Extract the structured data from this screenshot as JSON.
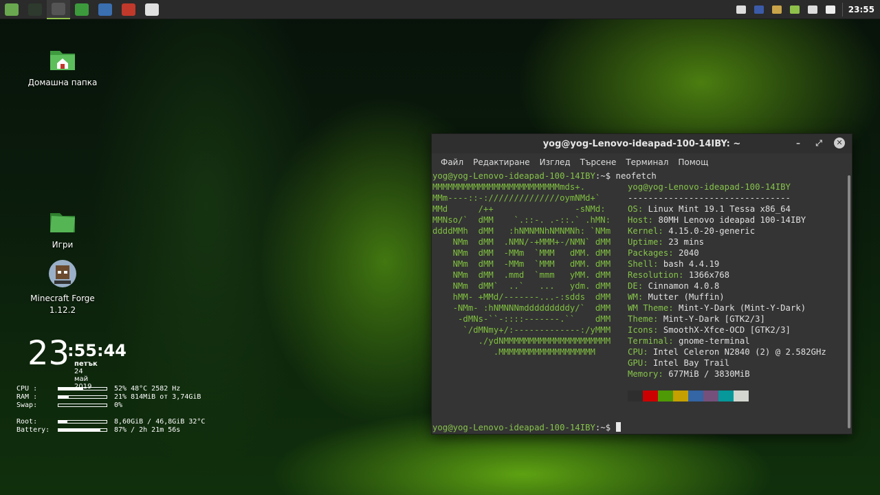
{
  "panel": {
    "launchers": [
      {
        "name": "mint-menu-icon",
        "color": "#6aa84f"
      },
      {
        "name": "terminal-launcher-icon",
        "color": "#2d3a2d"
      },
      {
        "name": "terminal-window-icon",
        "color": "#555"
      },
      {
        "name": "files-launcher-icon",
        "color": "#3c9a3c"
      },
      {
        "name": "browser-launcher-icon",
        "color": "#3a6fb0"
      },
      {
        "name": "monitor-launcher-icon",
        "color": "#c0392b"
      },
      {
        "name": "shield-launcher-icon",
        "color": "#e0e0e0"
      }
    ],
    "tray": [
      "shield-tray-icon",
      "us-flag-icon",
      "folder-tray-icon",
      "network-icon",
      "volume-icon",
      "battery-icon"
    ],
    "clock": "23:55"
  },
  "desktop": {
    "icons": [
      {
        "label": "Домашна папка"
      },
      {
        "label": "Игри"
      },
      {
        "label_line1": "Minecraft Forge",
        "label_line2": "1.12.2"
      }
    ]
  },
  "conky": {
    "hour": "23",
    "min_sec": ":55:44",
    "day": "петък",
    "date": "24 май 2019",
    "stats": [
      {
        "key": "CPU :",
        "fill": 0.52,
        "value": "52%  48°C 2582 Hz"
      },
      {
        "key": "RAM :",
        "fill": 0.21,
        "value": "21% 814MiB от 3,74GiB"
      },
      {
        "key": "Swap:",
        "fill": 0.0,
        "value": "0%"
      },
      {
        "key": "Root:",
        "fill": 0.19,
        "value": "8,60GiB / 46,8GiB 32°C"
      },
      {
        "key": "Battery:",
        "fill": 0.87,
        "value": "87% / 2h 21m 56s"
      }
    ]
  },
  "terminal": {
    "title": "yog@yog-Lenovo-ideapad-100-14IBY: ~",
    "menu": [
      "Файл",
      "Редактиране",
      "Изглед",
      "Търсене",
      "Терминал",
      "Помощ"
    ],
    "prompt": "yog@yog-Lenovo-ideapad-100-14IBY",
    "prompt_suffix": ":~$",
    "command": " neofetch",
    "logo_lines": [
      "MMMMMMMMMMMMMMMMMMMMMMMMMmds+.",
      "MMm----::-://////////////oymNMd+`",
      "MMd      /++                -sNMd:",
      "MMNso/`  dMM    `.::-. .-::.` .hMN:",
      "ddddMMh  dMM   :hNMNMNhNMNMNh: `NMm",
      "    NMm  dMM  .NMN/-+MMM+-/NMN` dMM",
      "    NMm  dMM  -MMm  `MMM   dMM. dMM",
      "    NMm  dMM  -MMm  `MMM   dMM. dMM",
      "    NMm  dMM  .mmd  `mmm   yMM. dMM",
      "    NMm  dMM`  ..`   ...   ydm. dMM",
      "    hMM- +MMd/-------...-:sdds  dMM",
      "    -NMm- :hNMNNNmdddddddddy/`  dMM",
      "     -dMNs-``-::::-------.``    dMM",
      "      `/dMNmy+/:-------------:/yMMM",
      "         ./ydNMMMMMMMMMMMMMMMMMMMMM",
      "            .MMMMMMMMMMMMMMMMMMM"
    ],
    "info_title": "yog@yog-Lenovo-ideapad-100-14IBY",
    "info_sep": "--------------------------------",
    "info": [
      {
        "k": "OS",
        "v": "Linux Mint 19.1 Tessa x86_64"
      },
      {
        "k": "Host",
        "v": "80MH Lenovo ideapad 100-14IBY"
      },
      {
        "k": "Kernel",
        "v": "4.15.0-20-generic"
      },
      {
        "k": "Uptime",
        "v": "23 mins"
      },
      {
        "k": "Packages",
        "v": "2040"
      },
      {
        "k": "Shell",
        "v": "bash 4.4.19"
      },
      {
        "k": "Resolution",
        "v": "1366x768"
      },
      {
        "k": "DE",
        "v": "Cinnamon 4.0.8"
      },
      {
        "k": "WM",
        "v": "Mutter (Muffin)"
      },
      {
        "k": "WM Theme",
        "v": "Mint-Y-Dark (Mint-Y-Dark)"
      },
      {
        "k": "Theme",
        "v": "Mint-Y-Dark [GTK2/3]"
      },
      {
        "k": "Icons",
        "v": "SmoothX-Xfce-OCD [GTK2/3]"
      },
      {
        "k": "Terminal",
        "v": "gnome-terminal"
      },
      {
        "k": "CPU",
        "v": "Intel Celeron N2840 (2) @ 2.582GHz"
      },
      {
        "k": "GPU",
        "v": "Intel Bay Trail"
      },
      {
        "k": "Memory",
        "v": "677MiB / 3830MiB"
      }
    ],
    "palette": [
      "#2e2e2e",
      "#cc0000",
      "#4e9a06",
      "#c4a000",
      "#3465a4",
      "#75507b",
      "#06989a",
      "#d3d7cf"
    ]
  }
}
